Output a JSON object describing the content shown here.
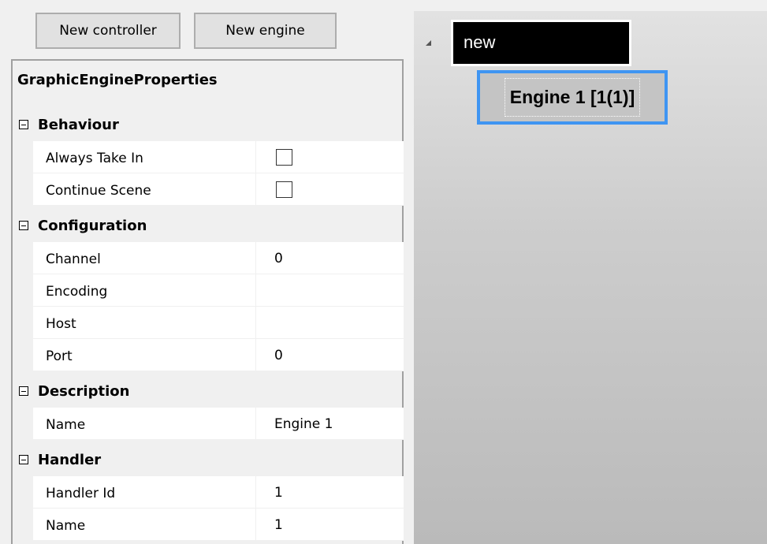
{
  "toolbar": {
    "new_controller_label": "New controller",
    "new_engine_label": "New engine"
  },
  "property_grid": {
    "title": "GraphicEngineProperties",
    "categories": [
      {
        "label": "Behaviour",
        "properties": [
          {
            "name": "Always Take In",
            "type": "checkbox",
            "checked": false
          },
          {
            "name": "Continue Scene",
            "type": "checkbox",
            "checked": false
          }
        ]
      },
      {
        "label": "Configuration",
        "properties": [
          {
            "name": "Channel",
            "value": "0"
          },
          {
            "name": "Encoding",
            "value": ""
          },
          {
            "name": "Host",
            "value": ""
          },
          {
            "name": "Port",
            "value": "0"
          }
        ]
      },
      {
        "label": "Description",
        "properties": [
          {
            "name": "Name",
            "value": "Engine 1"
          }
        ]
      },
      {
        "label": "Handler",
        "properties": [
          {
            "name": "Handler Id",
            "value": "1"
          },
          {
            "name": "Name",
            "value": "1"
          }
        ]
      }
    ]
  },
  "tree": {
    "root_label": "new",
    "child_label": "Engine 1 [1(1)]",
    "expand_icon": "triangle-expanded-icon",
    "selection_color": "#3f95f2"
  }
}
